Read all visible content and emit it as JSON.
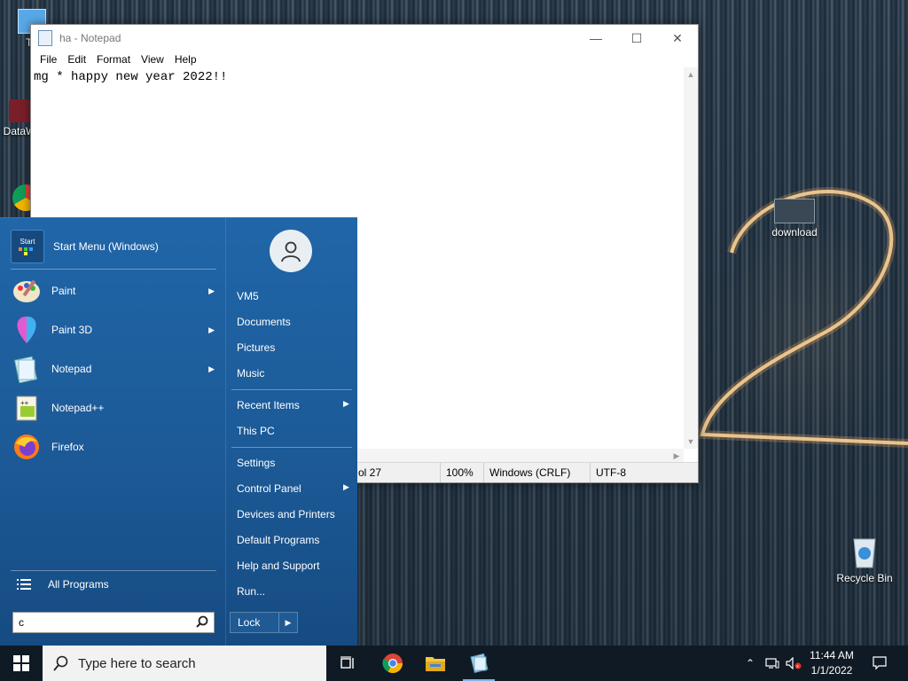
{
  "desktop": {
    "icons": [
      {
        "label": "Th"
      },
      {
        "label": "DataW"
      },
      {
        "label": "download"
      },
      {
        "label": "Recycle Bin"
      }
    ]
  },
  "notepad": {
    "title": "ha - Notepad",
    "menu": [
      "File",
      "Edit",
      "Format",
      "View",
      "Help"
    ],
    "content": "mg * happy new year 2022!!",
    "status": {
      "position": "ol 27",
      "zoom": "100%",
      "line_ending": "Windows (CRLF)",
      "encoding": "UTF-8"
    }
  },
  "start_menu": {
    "header": "Start Menu (Windows)",
    "header_icon_text": "Start",
    "programs": [
      {
        "label": "Paint",
        "icon": "paint-icon",
        "has_submenu": true
      },
      {
        "label": "Paint 3D",
        "icon": "paint-3d-icon",
        "has_submenu": true
      },
      {
        "label": "Notepad",
        "icon": "notepad-icon",
        "has_submenu": true
      },
      {
        "label": "Notepad++",
        "icon": "notepad-plus-plus-icon",
        "has_submenu": false
      },
      {
        "label": "Firefox",
        "icon": "firefox-icon",
        "has_submenu": false
      }
    ],
    "all_programs": "All Programs",
    "search_value": "c",
    "right": {
      "user": "VM5",
      "group1": [
        "Documents",
        "Pictures",
        "Music"
      ],
      "group2": [
        "Recent Items",
        "This PC"
      ],
      "group3": [
        "Settings",
        "Control Panel",
        "Devices and Printers",
        "Default Programs",
        "Help and Support",
        "Run..."
      ]
    },
    "lock_label": "Lock"
  },
  "taskbar": {
    "search_placeholder": "Type here to search",
    "time": "11:44 AM",
    "date": "1/1/2022"
  },
  "colors": {
    "start_menu_bg": "#1c5a97",
    "taskbar_bg": "#101a24",
    "accent": "#7fb4e8"
  }
}
